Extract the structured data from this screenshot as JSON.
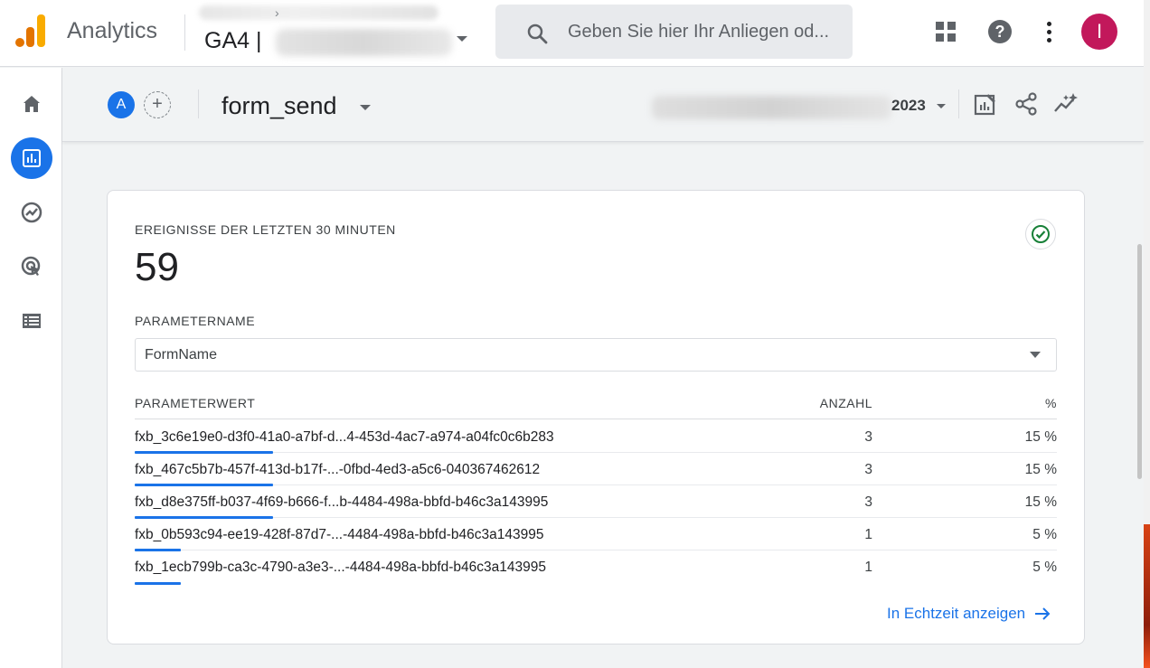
{
  "header": {
    "app_title": "Analytics",
    "property_label": "GA4 |",
    "search_placeholder": "Geben Sie hier Ihr Anliegen od..."
  },
  "account": {
    "avatar_initial": "I",
    "avatar_color": "#c2185b"
  },
  "sidenav": {
    "items": [
      "home-icon",
      "reports-icon",
      "explore-icon",
      "advertising-icon",
      "configure-icon"
    ],
    "active": "reports-icon"
  },
  "subheader": {
    "compare_badge": "A",
    "add_label": "+",
    "event_name": "form_send",
    "date_year": "2023"
  },
  "card": {
    "metric_label": "EREIGNISSE DER LETZTEN 30 MINUTEN",
    "metric_value": "59",
    "param_label": "PARAMETERNAME",
    "param_selected": "FormName",
    "columns": {
      "value": "PARAMETERWERT",
      "count": "ANZAHL",
      "percent": "%"
    },
    "rows": [
      {
        "name": "fxb_3c6e19e0-d3f0-41a0-a7bf-d...4-453d-4ac7-a974-a04fc0c6b283",
        "count": "3",
        "percent": "15 %",
        "share": 0.15
      },
      {
        "name": "fxb_467c5b7b-457f-413d-b17f-...-0fbd-4ed3-a5c6-040367462612",
        "count": "3",
        "percent": "15 %",
        "share": 0.15
      },
      {
        "name": "fxb_d8e375ff-b037-4f69-b666-f...b-4484-498a-bbfd-b46c3a143995",
        "count": "3",
        "percent": "15 %",
        "share": 0.15
      },
      {
        "name": "fxb_0b593c94-ee19-428f-87d7-...-4484-498a-bbfd-b46c3a143995",
        "count": "1",
        "percent": "5 %",
        "share": 0.05
      },
      {
        "name": "fxb_1ecb799b-ca3c-4790-a3e3-...-4484-498a-bbfd-b46c3a143995",
        "count": "1",
        "percent": "5 %",
        "share": 0.05
      }
    ],
    "link_label": "In Echtzeit anzeigen"
  },
  "colors": {
    "accent": "#1a73e8",
    "success": "#188038"
  }
}
